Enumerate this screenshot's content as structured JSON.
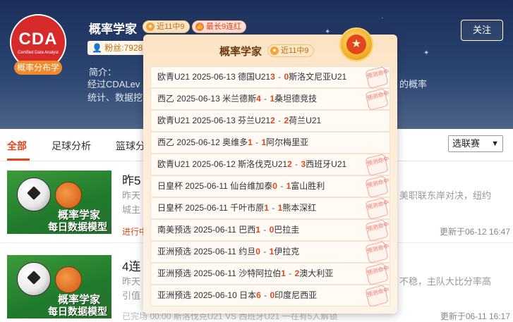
{
  "profile": {
    "logo_text": "CDA",
    "logo_sub": "Certified Data Analyst",
    "logo_tag": "概率分布学",
    "name": "概率学家",
    "badge_rate": "近11中9",
    "badge_streak": "最长9连红",
    "fans_label": "粉丝:7928",
    "intro_label": "简介：",
    "intro_text": "经过CDALev                                                      的概率统计、数据挖",
    "intro_tail": "的概率",
    "follow_label": "关注",
    "intro_line1_start": "经过CDALev",
    "intro_line2_start": "统计、数据挖"
  },
  "tabs": {
    "items": [
      "全部",
      "足球分析",
      "篮球分"
    ],
    "active": "全部",
    "select_value": "选联赛"
  },
  "articles": [
    {
      "thumb_line1": "概率学家",
      "thumb_line2": "每日数据模型",
      "title": "昨5",
      "desc_start": "昨天",
      "desc_right": "美职联东岸对决，纽约",
      "desc_line2": "城主",
      "status": "进行中",
      "updated": "更新于06-12 16:47"
    },
    {
      "thumb_line1": "概率学家",
      "thumb_line2": "每日数据模型",
      "title": "4连",
      "desc_start": "昨天",
      "desc_right": "不稳，主队大比分率高",
      "desc_line2": "引值",
      "status": "",
      "meta": "已完场 00:00 斯洛伐克U21 VS 西班牙U21 一在有5人解锁",
      "updated": "更新于06-11 16:17"
    }
  ],
  "popover": {
    "title": "概率学家",
    "badge": "近11中9",
    "stamp_text": "预测命中",
    "matches": [
      {
        "league": "欧青U21",
        "date": "2025-06-13",
        "home": "德国U21",
        "hs": "3",
        "as": "0",
        "away": "斯洛文尼亚U21",
        "hit": true
      },
      {
        "league": "西乙",
        "date": "2025-06-13",
        "home": "米兰德斯",
        "hs": "4",
        "as": "1",
        "away": "桑坦德竞技",
        "hit": true
      },
      {
        "league": "欧青U21",
        "date": "2025-06-13",
        "home": "芬兰U21",
        "hs": "2",
        "as": "2",
        "away": "荷兰U21",
        "hit": false
      },
      {
        "league": "西乙",
        "date": "2025-06-12",
        "home": "奥维多",
        "hs": "1",
        "as": "1",
        "away": "阿尔梅里亚",
        "hit": false
      },
      {
        "league": "欧青U21",
        "date": "2025-06-12",
        "home": "斯洛伐克U21",
        "hs": "2",
        "as": "3",
        "away": "西班牙U21",
        "hit": true
      },
      {
        "league": "日皇杯",
        "date": "2025-06-11",
        "home": "仙台维加泰",
        "hs": "0",
        "as": "1",
        "away": "富山胜利",
        "hit": true
      },
      {
        "league": "日皇杯",
        "date": "2025-06-11",
        "home": "千叶市原",
        "hs": "1",
        "as": "1",
        "away": "熊本深红",
        "hit": true
      },
      {
        "league": "南美预选",
        "date": "2025-06-11",
        "home": "巴西",
        "hs": "1",
        "as": "0",
        "away": "巴拉圭",
        "hit": true
      },
      {
        "league": "亚洲预选",
        "date": "2025-06-11",
        "home": "约旦",
        "hs": "0",
        "as": "1",
        "away": "伊拉克",
        "hit": true
      },
      {
        "league": "亚洲预选",
        "date": "2025-06-11",
        "home": "沙特阿拉伯",
        "hs": "1",
        "as": "2",
        "away": "澳大利亚",
        "hit": true
      },
      {
        "league": "亚洲预选",
        "date": "2025-06-10",
        "home": "日本",
        "hs": "6",
        "as": "0",
        "away": "印度尼西亚",
        "hit": true
      }
    ]
  },
  "colors": {
    "accent": "#e2461d",
    "banner": "#2b4470",
    "popover_bg": "#fde9d1"
  }
}
